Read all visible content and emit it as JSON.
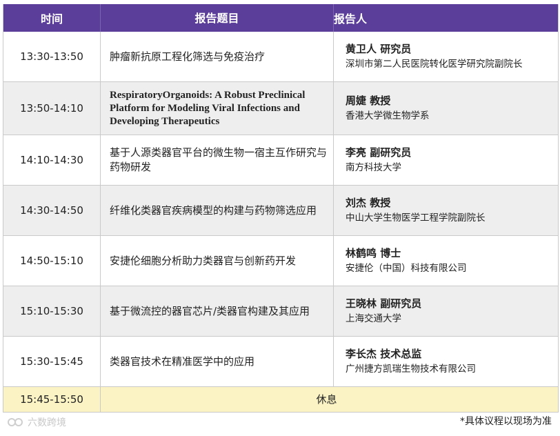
{
  "header": {
    "time": "时间",
    "topic": "报告题目",
    "speaker": "报告人"
  },
  "rows": [
    {
      "time": "13:30-13:50",
      "topic": "肿瘤新抗原工程化筛选与免疫治疗",
      "name": "黄卫人 研究员",
      "affiliation": "深圳市第二人民医院转化医学研究院副院长"
    },
    {
      "time": "13:50-14:10",
      "topic": "RespiratoryOrganoids: A Robust Preclinical Platform for Modeling Viral Infections and Developing Therapeutics",
      "name": "周婕 教授",
      "affiliation": "香港大学微生物学系"
    },
    {
      "time": "14:10-14:30",
      "topic": "基于人源类器官平台的微生物一宿主互作研究与药物研发",
      "name": "李亮 副研究员",
      "affiliation": "南方科技大学"
    },
    {
      "time": "14:30-14:50",
      "topic": "纤维化类器官疾病模型的构建与药物筛选应用",
      "name": "刘杰 教授",
      "affiliation": "中山大学生物医学工程学院副院长"
    },
    {
      "time": "14:50-15:10",
      "topic": "安捷伦细胞分析助力类器官与创新药开发",
      "name": "林鹤鸣 博士",
      "affiliation": "安捷伦（中国）科技有限公司"
    },
    {
      "time": "15:10-15:30",
      "topic": "基于微流控的器官芯片/类器官构建及其应用",
      "name": "王晓林 副研究员",
      "affiliation": "上海交通大学"
    },
    {
      "time": "15:30-15:45",
      "topic": "类器官技术在精准医学中的应用",
      "name": "李长杰  技术总监",
      "affiliation": "广州捷方凯瑞生物技术有限公司"
    }
  ],
  "break_row": {
    "time": "15:45-15:50",
    "label": "休息"
  },
  "footer": {
    "note": "*具体议程以现场为准",
    "watermark": "六数跨境",
    "watermark_icon": "logo-icon"
  },
  "colors": {
    "header_bg": "#5b3e9a",
    "shade": "#eeeeee",
    "break_bg": "#fbf3c4"
  }
}
